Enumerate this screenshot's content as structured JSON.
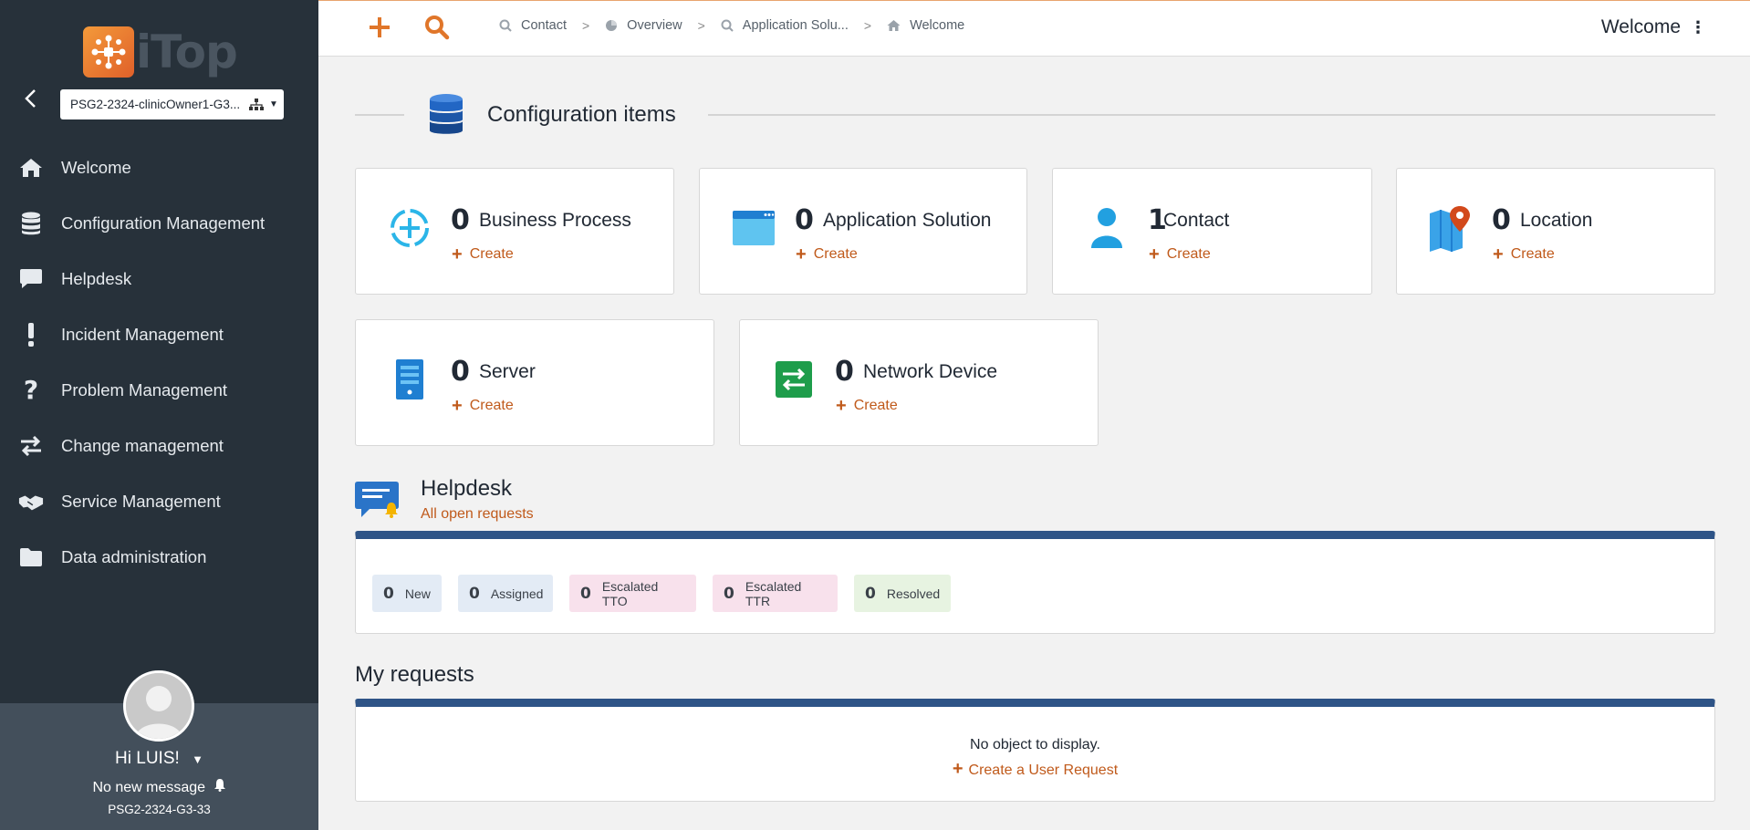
{
  "sidebar": {
    "logo_text": "iTop",
    "organization": "PSG2-2324-clinicOwner1-G3...",
    "items": [
      {
        "label": "Welcome",
        "icon": "home-icon"
      },
      {
        "label": "Configuration Management",
        "icon": "database-icon"
      },
      {
        "label": "Helpdesk",
        "icon": "chat-icon"
      },
      {
        "label": "Incident Management",
        "icon": "exclamation-icon"
      },
      {
        "label": "Problem Management",
        "icon": "question-icon"
      },
      {
        "label": "Change management",
        "icon": "exchange-icon"
      },
      {
        "label": "Service Management",
        "icon": "handshake-icon"
      },
      {
        "label": "Data administration",
        "icon": "folder-icon"
      }
    ],
    "user": {
      "greeting": "Hi LUIS!",
      "messages": "No new message",
      "org": "PSG2-2324-G3-33"
    }
  },
  "topbar": {
    "breadcrumb": [
      {
        "label": "Contact",
        "icon": "search-icon"
      },
      {
        "label": "Overview",
        "icon": "pie-chart-icon"
      },
      {
        "label": "Application Solu...",
        "icon": "search-icon"
      },
      {
        "label": "Welcome",
        "icon": "home-icon"
      }
    ],
    "welcome": "Welcome"
  },
  "config_items": {
    "title": "Configuration items",
    "create_label": "Create",
    "cards": [
      {
        "count": "0",
        "name": "Business Process",
        "icon": "business-process-icon"
      },
      {
        "count": "0",
        "name": "Application Solution",
        "icon": "application-window-icon"
      },
      {
        "count": "1",
        "name": "Contact",
        "icon": "person-icon"
      },
      {
        "count": "0",
        "name": "Location",
        "icon": "map-pin-icon"
      },
      {
        "count": "0",
        "name": "Server",
        "icon": "server-icon"
      },
      {
        "count": "0",
        "name": "Network Device",
        "icon": "network-arrows-icon"
      }
    ]
  },
  "helpdesk": {
    "title": "Helpdesk",
    "link": "All open requests",
    "badges": [
      {
        "count": "0",
        "label": "New",
        "color": "#e3ebf5"
      },
      {
        "count": "0",
        "label": "Assigned",
        "color": "#e3ebf5"
      },
      {
        "count": "0",
        "label": "Escalated TTO",
        "color": "#f8e1ec"
      },
      {
        "count": "0",
        "label": "Escalated TTR",
        "color": "#f8e1ec"
      },
      {
        "count": "0",
        "label": "Resolved",
        "color": "#e7f3e1"
      }
    ]
  },
  "my_requests": {
    "title": "My requests",
    "empty": "No object to display.",
    "create": "Create a User Request"
  },
  "colors": {
    "accent": "#c05a1b",
    "sidebar_bg": "#27313a",
    "panel_border": "#2e5487"
  }
}
